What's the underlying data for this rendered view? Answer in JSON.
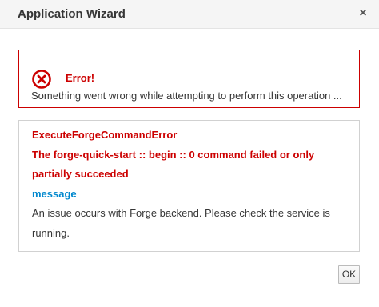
{
  "dialog": {
    "title": "Application Wizard",
    "close_icon": "close-icon",
    "close_glyph": "×"
  },
  "alert": {
    "icon": "error-circle-icon",
    "title": "Error!",
    "message": "Something went wrong while attempting to perform this operation ..."
  },
  "details": {
    "error_name": "ExecuteForgeCommandError",
    "error_line1": "The forge-quick-start :: begin :: 0 command failed or only",
    "error_line2": "partially succeeded",
    "message_key": "message",
    "message_line1": "An issue occurs with Forge backend. Please check the service is",
    "message_line2": "running."
  },
  "footer": {
    "ok_label": "OK"
  },
  "colors": {
    "error": "#cc0000",
    "link": "#0088ce"
  }
}
